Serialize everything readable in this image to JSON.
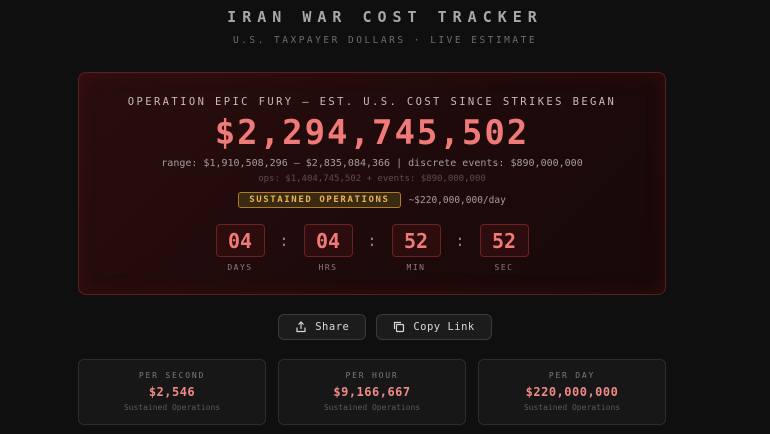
{
  "header": {
    "title": "IRAN WAR COST TRACKER",
    "subtitle": "U.S. TAXPAYER DOLLARS · LIVE ESTIMATE"
  },
  "card": {
    "heading": "OPERATION EPIC FURY — EST. U.S. COST SINCE STRIKES BEGAN",
    "amount": "$2,294,745,502",
    "range": "range: $1,910,508,296 – $2,835,084,366 | discrete events: $890,000,000",
    "ops": "ops: $1,404,745,502 + events: $890,000,000",
    "badge": "SUSTAINED OPERATIONS",
    "rate": "~$220,000,000/day",
    "timer": [
      {
        "value": "04",
        "label": "DAYS"
      },
      {
        "value": "04",
        "label": "HRS"
      },
      {
        "value": "52",
        "label": "MIN"
      },
      {
        "value": "52",
        "label": "SEC"
      }
    ],
    "separator": ":"
  },
  "actions": {
    "share_label": "Share",
    "copy_label": "Copy Link",
    "share_icon": "share-icon",
    "copy_icon": "copy-icon"
  },
  "stats": [
    {
      "label": "PER SECOND",
      "value": "$2,546",
      "sub": "Sustained Operations"
    },
    {
      "label": "PER HOUR",
      "value": "$9,166,667",
      "sub": "Sustained Operations"
    },
    {
      "label": "PER DAY",
      "value": "$220,000,000",
      "sub": "Sustained Operations"
    }
  ],
  "colors": {
    "accent": "#f07a78",
    "badge": "#e7b457",
    "background": "#0f0f0f"
  }
}
